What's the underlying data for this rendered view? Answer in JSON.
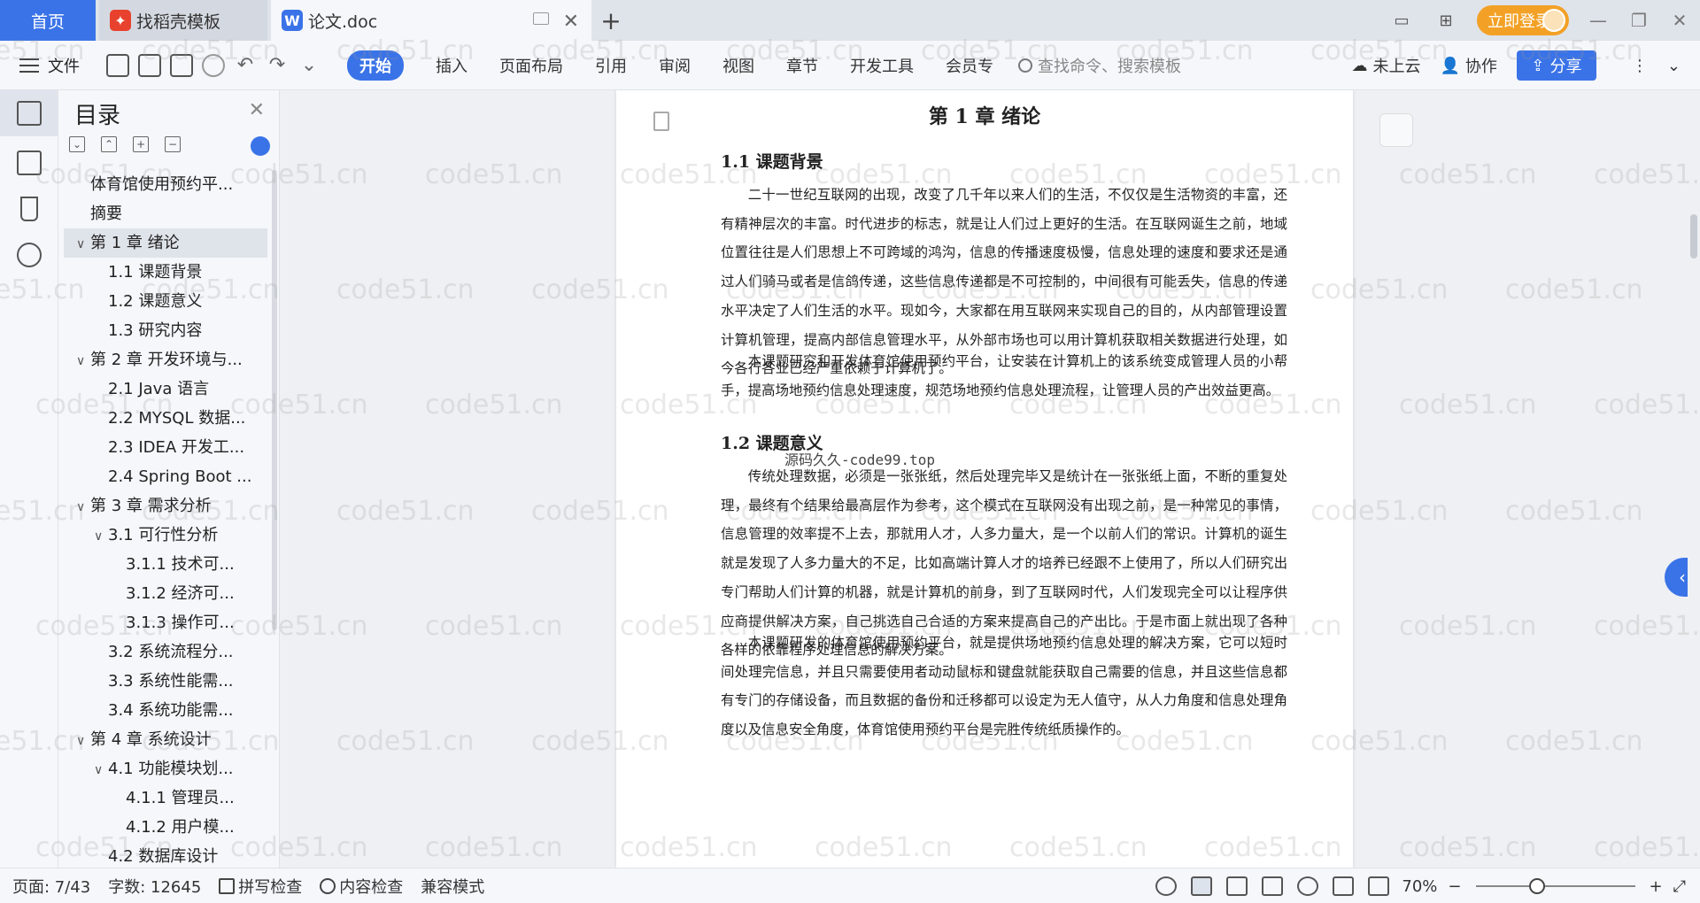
{
  "titlebar": {
    "home_tab": "首页",
    "tab1_label": "找稻壳模板",
    "tab2_label": "论文.doc",
    "login_label": "立即登录"
  },
  "toolbar": {
    "file_label": "文件",
    "tabs": [
      "开始",
      "插入",
      "页面布局",
      "引用",
      "审阅",
      "视图",
      "章节",
      "开发工具",
      "会员专"
    ],
    "search_placeholder": "查找命令、搜索模板",
    "cloud_label": "未上云",
    "collab_label": "协作",
    "share_label": "分享"
  },
  "toc": {
    "title": "目录",
    "items": [
      {
        "label": "体育馆使用预约平...",
        "level": 0,
        "chev": ""
      },
      {
        "label": "摘要",
        "level": 0,
        "chev": ""
      },
      {
        "label": "第 1 章  绪论",
        "level": 0,
        "chev": "∨",
        "selected": true
      },
      {
        "label": "1.1  课题背景",
        "level": 1,
        "chev": ""
      },
      {
        "label": "1.2  课题意义",
        "level": 1,
        "chev": ""
      },
      {
        "label": "1.3  研究内容",
        "level": 1,
        "chev": ""
      },
      {
        "label": "第 2 章  开发环境与...",
        "level": 0,
        "chev": "∨"
      },
      {
        "label": "2.1 Java 语言",
        "level": 1,
        "chev": ""
      },
      {
        "label": "2.2 MYSQL 数据...",
        "level": 1,
        "chev": ""
      },
      {
        "label": "2.3 IDEA 开发工...",
        "level": 1,
        "chev": ""
      },
      {
        "label": "2.4 Spring Boot ...",
        "level": 1,
        "chev": ""
      },
      {
        "label": "第 3 章  需求分析",
        "level": 0,
        "chev": "∨"
      },
      {
        "label": "3.1  可行性分析",
        "level": 1,
        "chev": "∨"
      },
      {
        "label": "3.1.1  技术可...",
        "level": 2,
        "chev": ""
      },
      {
        "label": "3.1.2  经济可...",
        "level": 2,
        "chev": ""
      },
      {
        "label": "3.1.3  操作可...",
        "level": 2,
        "chev": ""
      },
      {
        "label": "3.2  系统流程分...",
        "level": 1,
        "chev": ""
      },
      {
        "label": "3.3  系统性能需...",
        "level": 1,
        "chev": ""
      },
      {
        "label": "3.4  系统功能需...",
        "level": 1,
        "chev": ""
      },
      {
        "label": "第 4 章  系统设计",
        "level": 0,
        "chev": "∨"
      },
      {
        "label": "4.1  功能模块划...",
        "level": 1,
        "chev": "∨"
      },
      {
        "label": "4.1.1  管理员...",
        "level": 2,
        "chev": ""
      },
      {
        "label": "4.1.2  用户模...",
        "level": 2,
        "chev": ""
      },
      {
        "label": "4.2  数据库设计",
        "level": 1,
        "chev": ""
      }
    ]
  },
  "document": {
    "chapter_title": "第 1 章  绪论",
    "sec1_title": "1.1  课题背景",
    "sec1_p1": "二十一世纪互联网的出现，改变了几千年以来人们的生活，不仅仅是生活物资的丰富，还有精神层次的丰富。时代进步的标志，就是让人们过上更好的生活。在互联网诞生之前，地域位置往往是人们思想上不可跨域的鸿沟，信息的传播速度极慢，信息处理的速度和要求还是通过人们骑马或者是信鸽传递，这些信息传递都是不可控制的，中间很有可能丢失，信息的传递水平决定了人们生活的水平。现如今，大家都在用互联网来实现自己的目的，从内部管理设置计算机管理，提高内部信息管理水平，从外部市场也可以用计算机获取相关数据进行处理，如今各行各业已经严重依赖于计算机了。",
    "sec1_p2": "本课题研究和开发体育馆使用预约平台，让安装在计算机上的该系统变成管理人员的小帮手，提高场地预约信息处理速度，规范场地预约信息处理流程，让管理人员的产出效益更高。",
    "inline_watermark": "源码久久-code99.top",
    "sec2_title": "1.2  课题意义",
    "sec2_p1": "传统处理数据，必须是一张张纸，然后处理完毕又是统计在一张张纸上面，不断的重复处理，最终有个结果给最高层作为参考，这个模式在互联网没有出现之前，是一种常见的事情，信息管理的效率提不上去，那就用人才，人多力量大，是一个以前人们的常识。计算机的诞生就是发现了人多力量大的不足，比如高端计算人才的培养已经跟不上使用了，所以人们研究出专门帮助人们计算的机器，就是计算机的前身，到了互联网时代，人们发现完全可以让程序供应商提供解决方案，自己挑选自己合适的方案来提高自己的产出比。于是市面上就出现了各种各样的依靠程序处理信息的解决方案。",
    "sec2_p2": "本课题研发的体育馆使用预约平台，就是提供场地预约信息处理的解决方案，它可以短时间处理完信息，并且只需要使用者动动鼠标和键盘就能获取自己需要的信息，并且这些信息都有专门的存储设备，而且数据的备份和迁移都可以设定为无人值守，从人力角度和信息处理角度以及信息安全角度，体育馆使用预约平台是完胜传统纸质操作的。"
  },
  "statusbar": {
    "page": "页面: 7/43",
    "words": "字数: 12645",
    "spell": "拼写检查",
    "content_check": "内容检查",
    "compat": "兼容模式",
    "zoom": "70%"
  },
  "watermark_text": "code51.cn"
}
